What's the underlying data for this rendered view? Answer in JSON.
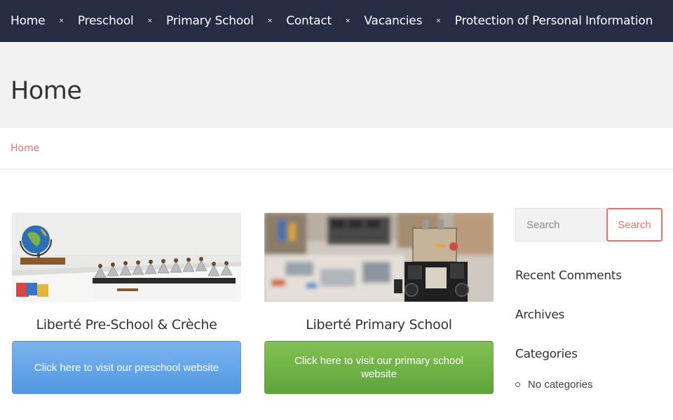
{
  "nav": {
    "items": [
      {
        "label": "Home"
      },
      {
        "label": "Preschool"
      },
      {
        "label": "Primary School"
      },
      {
        "label": "Contact"
      },
      {
        "label": "Vacancies"
      },
      {
        "label": "Protection of Personal Information"
      }
    ],
    "separator": "×"
  },
  "page": {
    "title": "Home",
    "breadcrumb": "Home"
  },
  "cards": [
    {
      "title": "Liberté Pre-School & Crèche",
      "button_label": "Click here to visit our preschool website"
    },
    {
      "title": "Liberté Primary School",
      "button_label": "Click here to visit our primary school website"
    }
  ],
  "sidebar": {
    "search_placeholder": "Search",
    "search_button": "Search",
    "recent_comments": "Recent Comments",
    "archives": "Archives",
    "categories": "Categories",
    "category_items": [
      "No categories"
    ]
  },
  "colors": {
    "nav_bg": "#252d45",
    "accent": "#e8736b",
    "blue_button": "#5198e3",
    "green_button": "#6aad45"
  }
}
